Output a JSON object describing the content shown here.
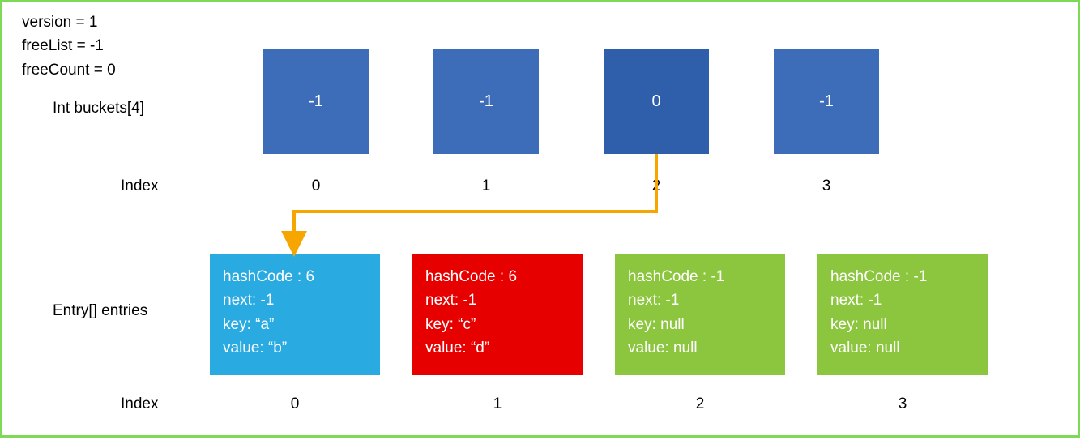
{
  "meta": {
    "version_line": "version = 1",
    "freeList_line": "freeList = -1",
    "freeCount_line": "freeCount = 0"
  },
  "labels": {
    "buckets": "Int buckets[4]",
    "entries": "Entry[] entries",
    "index": "Index"
  },
  "buckets": [
    {
      "value": "-1",
      "hit": false
    },
    {
      "value": "-1",
      "hit": false
    },
    {
      "value": "0",
      "hit": true
    },
    {
      "value": "-1",
      "hit": false
    }
  ],
  "bucket_indexes": [
    "0",
    "1",
    "2",
    "3"
  ],
  "entries": [
    {
      "color": "cyan",
      "hashCode": "hashCode : 6",
      "next": "next: -1",
      "key": "key: “a”",
      "value": "value: “b”"
    },
    {
      "color": "red",
      "hashCode": "hashCode : 6",
      "next": "next: -1",
      "key": "key: “c”",
      "value": "value: “d”"
    },
    {
      "color": "green",
      "hashCode": "hashCode : -1",
      "next": "next: -1",
      "key": "key: null",
      "value": "value: null"
    },
    {
      "color": "green",
      "hashCode": "hashCode : -1",
      "next": "next: -1",
      "key": "key: null",
      "value": "value: null"
    }
  ],
  "entry_indexes": [
    "0",
    "1",
    "2",
    "3"
  ],
  "colors": {
    "border": "#7ed957",
    "bucket": "#3d6cb9",
    "bucket_hit": "#2f5faa",
    "cyan": "#29abe2",
    "red": "#e60000",
    "green": "#8cc63f",
    "arrow": "#f7a600"
  },
  "arrow": {
    "from_bucket_index": 2,
    "to_entry_index": 0
  }
}
